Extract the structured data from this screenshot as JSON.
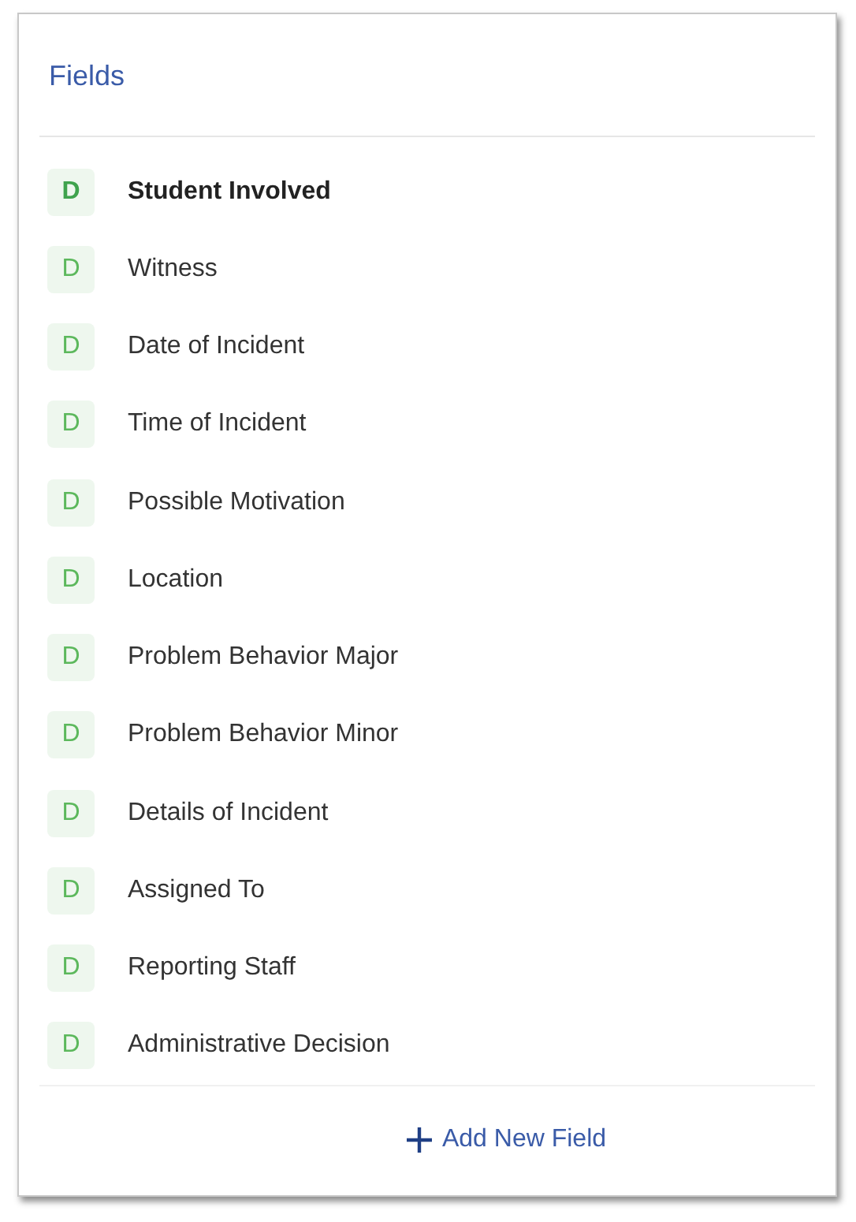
{
  "panel": {
    "title": "Fields"
  },
  "fields": [
    {
      "badge": "D",
      "label": "Student Involved",
      "selected": true
    },
    {
      "badge": "D",
      "label": "Witness",
      "selected": false
    },
    {
      "badge": "D",
      "label": "Date of Incident",
      "selected": false
    },
    {
      "badge": "D",
      "label": "Time of Incident",
      "selected": false
    },
    {
      "badge": "D",
      "label": "Possible Motivation",
      "selected": false
    },
    {
      "badge": "D",
      "label": "Location",
      "selected": false
    },
    {
      "badge": "D",
      "label": "Problem Behavior Major",
      "selected": false
    },
    {
      "badge": "D",
      "label": "Problem Behavior Minor",
      "selected": false
    },
    {
      "badge": "D",
      "label": "Details of Incident",
      "selected": false
    },
    {
      "badge": "D",
      "label": "Assigned To",
      "selected": false
    },
    {
      "badge": "D",
      "label": "Reporting Staff",
      "selected": false
    },
    {
      "badge": "D",
      "label": "Administrative Decision",
      "selected": false
    }
  ],
  "add_button": {
    "label": "Add New Field"
  }
}
